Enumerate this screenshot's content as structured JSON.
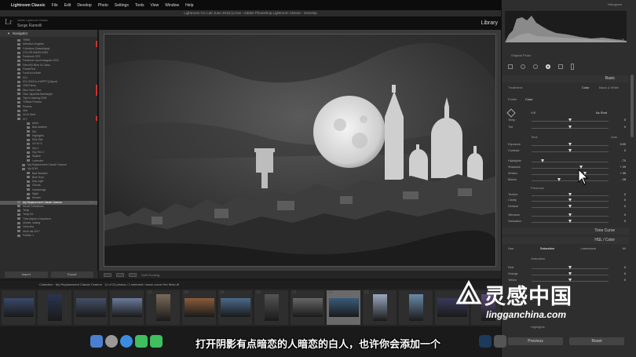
{
  "menubar": {
    "app": "Lightroom Classic",
    "items": [
      "File",
      "Edit",
      "Develop",
      "Photo",
      "Settings",
      "Tools",
      "View",
      "Window",
      "Help"
    ]
  },
  "window": {
    "title": "Lightroom CC Lab June 2018 (LrCat - Adobe Photoshop Lightroom Classic - Develop"
  },
  "identity": {
    "logo": "Lr",
    "line1": "Adobe Lightroom Classic",
    "line2": "Serge Ramelli",
    "module": "Library"
  },
  "left_panel": {
    "header": "Navigator",
    "items": [
      {
        "label": "TRBK",
        "count": ""
      },
      {
        "label": "Selection Angeles",
        "count": ""
      },
      {
        "label": "Collection (Vasseliapa)",
        "count": ""
      },
      {
        "label": "COLOR ANGELINES",
        "count": ""
      },
      {
        "label": "Facebook 3CS",
        "count": ""
      },
      {
        "label": "Facebook and Instagram 2022",
        "count": ""
      },
      {
        "label": "Film 600 Blue IO Class",
        "count": ""
      },
      {
        "label": "FinearFirst",
        "count": ""
      },
      {
        "label": "Food to include",
        "count": ""
      },
      {
        "label": "ICU",
        "count": ""
      },
      {
        "label": "ICU 2018 to (HAPPY)(Japon)",
        "count": ""
      },
      {
        "label": "Chill Fanny",
        "count": ""
      },
      {
        "label": "Nice York Color",
        "count": ""
      },
      {
        "label": "Own Japonfils Backslight",
        "count": ""
      },
      {
        "label": "Tips to blazing 2019",
        "count": ""
      },
      {
        "label": "TOBest Presets",
        "count": ""
      },
      {
        "label": "Presets",
        "count": ""
      },
      {
        "label": "Ulal",
        "count": ""
      },
      {
        "label": "ULAL Best",
        "count": ""
      },
      {
        "label": "IVY",
        "count": ""
      },
      {
        "label": "Artist",
        "count": ""
      },
      {
        "label": "Bad weather",
        "count": ""
      },
      {
        "label": "Dirt",
        "count": ""
      },
      {
        "label": "Highlights",
        "count": ""
      },
      {
        "label": "Rise Site",
        "count": ""
      },
      {
        "label": "US 40 S",
        "count": ""
      },
      {
        "label": "Sky 1",
        "count": ""
      },
      {
        "label": "Sky Fire 2",
        "count": ""
      },
      {
        "label": "Skyline",
        "count": ""
      },
      {
        "label": "Lavender",
        "count": ""
      },
      {
        "label": "My Replacement Claude Ceanne",
        "count": ""
      },
      {
        "label": "My 2019",
        "count": ""
      },
      {
        "label": "Bad Weather",
        "count": ""
      },
      {
        "label": "Blue Hour",
        "count": ""
      },
      {
        "label": "Day Light",
        "count": ""
      },
      {
        "label": "Clouds",
        "count": ""
      },
      {
        "label": "Hordenings",
        "count": ""
      },
      {
        "label": "Night",
        "count": ""
      },
      {
        "label": "Sunset",
        "count": ""
      },
      {
        "label": "My Replacement Claude Ceanne",
        "count": "24",
        "selected": true
      },
      {
        "label": "Smart Collections",
        "count": ""
      },
      {
        "label": "Temp",
        "count": ""
      },
      {
        "label": "Temp Ed",
        "count": ""
      },
      {
        "label": "Time Adjust Companion",
        "count": ""
      },
      {
        "label": "Ulower, salang",
        "count": ""
      },
      {
        "label": "Overview",
        "count": ""
      },
      {
        "label": "Work dai 2017",
        "count": ""
      },
      {
        "label": "Publish 1",
        "count": ""
      }
    ],
    "buttons": [
      "Import",
      "Export"
    ]
  },
  "toolbar": {
    "label": "Soft Proofing"
  },
  "filmstrip": {
    "path": "Collection : My Replacement Claude Ceanne",
    "info": "11 of 24 photos / 1 selected / ",
    "file": "sacre coeur Hnr Moln.tif"
  },
  "thumb_numbers": [
    "",
    "",
    "",
    "",
    "17",
    "18",
    "19",
    "20",
    "21",
    "22",
    "23",
    "",
    "",
    "26"
  ],
  "right_panel": {
    "histogram_label": "Histogram",
    "whites_readout": "Whites",
    "whites_value": "+ 39",
    "original_photo": "Original Photo",
    "basic": "Basic",
    "treatment_label": "Treatment:",
    "color": "Color",
    "bw": "Black & White",
    "profile_label": "Profile",
    "profile_value": "Color",
    "wb_label": "WB",
    "wb_value": "As Shot",
    "tone_label": "Tone",
    "tone_auto": "Auto",
    "presence_label": "Presence",
    "tone_curve": "Tone Curve",
    "hsl": "HSL / Color",
    "hsl_tabs": [
      "Hue",
      "Saturation",
      "Luminance",
      "All"
    ],
    "saturation_label": "Saturation",
    "highlights_bottom": "Highlights",
    "previous": "Previous",
    "reset": "Reset",
    "sliders": [
      {
        "label": "Temp",
        "value": "0",
        "pos": 0.5
      },
      {
        "label": "Tint",
        "value": "0",
        "pos": 0.5
      },
      {
        "label": "Exposure",
        "value": "0.00",
        "pos": 0.5
      },
      {
        "label": "Contrast",
        "value": "0",
        "pos": 0.5
      },
      {
        "label": "Highlights",
        "value": "- 70",
        "pos": 0.15
      },
      {
        "label": "Shadows",
        "value": "+ 29",
        "pos": 0.65
      },
      {
        "label": "Whites",
        "value": "+ 39",
        "pos": 0.7
      },
      {
        "label": "Blacks",
        "value": "- 28",
        "pos": 0.36
      },
      {
        "label": "Texture",
        "value": "0",
        "pos": 0.5
      },
      {
        "label": "Clarity",
        "value": "0",
        "pos": 0.5
      },
      {
        "label": "Dehaze",
        "value": "0",
        "pos": 0.5
      },
      {
        "label": "Vibrance",
        "value": "0",
        "pos": 0.5
      },
      {
        "label": "Saturation",
        "value": "0",
        "pos": 0.5
      },
      {
        "label": "Red",
        "value": "0",
        "pos": 0.5
      },
      {
        "label": "Orange",
        "value": "0",
        "pos": 0.5
      },
      {
        "label": "Yellow",
        "value": "0",
        "pos": 0.5
      }
    ]
  },
  "subtitle": "打开阴影有点暗恋的人暗恋的白人，也许你会添加一个",
  "watermark": {
    "title": "灵感中国",
    "url": "lingganchina.com"
  }
}
